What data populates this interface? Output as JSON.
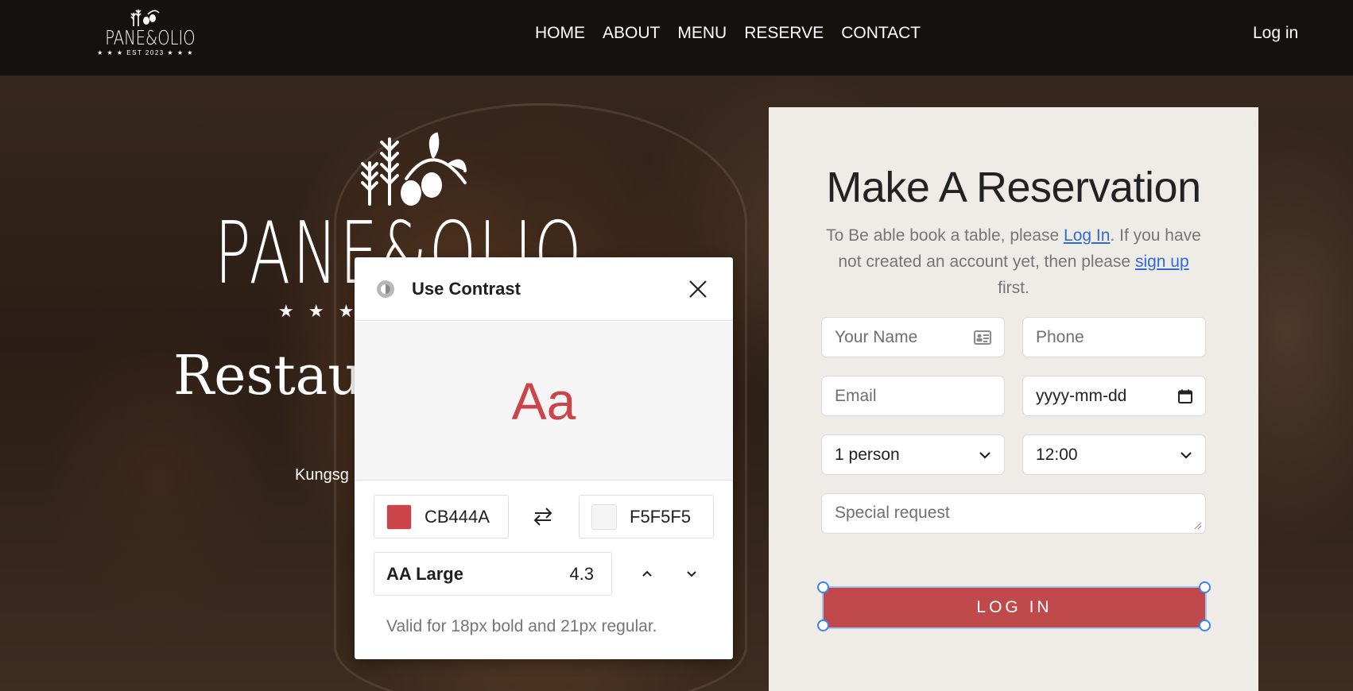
{
  "nav": {
    "logo": {
      "name": "PANE&OLIO",
      "sub": "★ ★ ★ EST 2023 ★ ★ ★"
    },
    "links": [
      "HOME",
      "ABOUT",
      "MENU",
      "RESERVE",
      "CONTACT"
    ],
    "login": "Log in"
  },
  "hero": {
    "brand": "PANE&OLIO",
    "stars": "★ ★ ★ E",
    "tagline": "Restaur",
    "address": "Kungsg"
  },
  "reservation": {
    "title": "Make A Reservation",
    "desc_before": "To Be able book a table, please ",
    "login_link": "Log In",
    "desc_middle": ". If you have not created an account yet, then please ",
    "signup_link": "sign up",
    "desc_after": " first.",
    "name_placeholder": "Your Name",
    "phone_placeholder": "Phone",
    "email_placeholder": "Email",
    "date_placeholder": "yyyy-mm-dd",
    "party_value": "1 person",
    "time_value": "12:00",
    "request_placeholder": "Special request",
    "button_label": "LOG IN",
    "button_color": "#C0494B"
  },
  "contrast": {
    "title": "Use Contrast",
    "sample": "Aa",
    "foreground": "CB444A",
    "background": "F5F5F5",
    "foreground_color": "#CB444A",
    "background_color": "#F5F5F5",
    "level": "AA Large",
    "ratio": "4.3",
    "note": "Valid for 18px bold and 21px regular."
  }
}
